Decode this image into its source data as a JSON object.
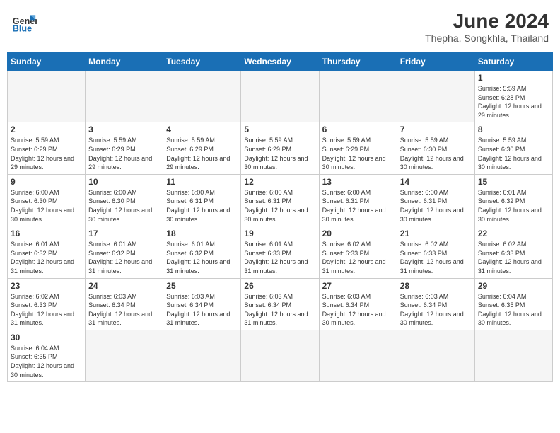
{
  "header": {
    "logo_general": "General",
    "logo_blue": "Blue",
    "month_title": "June 2024",
    "location": "Thepha, Songkhla, Thailand"
  },
  "weekdays": [
    "Sunday",
    "Monday",
    "Tuesday",
    "Wednesday",
    "Thursday",
    "Friday",
    "Saturday"
  ],
  "days": [
    {
      "date": "",
      "empty": true
    },
    {
      "date": "",
      "empty": true
    },
    {
      "date": "",
      "empty": true
    },
    {
      "date": "",
      "empty": true
    },
    {
      "date": "",
      "empty": true
    },
    {
      "date": "",
      "empty": true
    },
    {
      "date": "1",
      "sunrise": "Sunrise: 5:59 AM",
      "sunset": "Sunset: 6:28 PM",
      "daylight": "Daylight: 12 hours and 29 minutes."
    },
    {
      "date": "2",
      "sunrise": "Sunrise: 5:59 AM",
      "sunset": "Sunset: 6:29 PM",
      "daylight": "Daylight: 12 hours and 29 minutes."
    },
    {
      "date": "3",
      "sunrise": "Sunrise: 5:59 AM",
      "sunset": "Sunset: 6:29 PM",
      "daylight": "Daylight: 12 hours and 29 minutes."
    },
    {
      "date": "4",
      "sunrise": "Sunrise: 5:59 AM",
      "sunset": "Sunset: 6:29 PM",
      "daylight": "Daylight: 12 hours and 29 minutes."
    },
    {
      "date": "5",
      "sunrise": "Sunrise: 5:59 AM",
      "sunset": "Sunset: 6:29 PM",
      "daylight": "Daylight: 12 hours and 30 minutes."
    },
    {
      "date": "6",
      "sunrise": "Sunrise: 5:59 AM",
      "sunset": "Sunset: 6:29 PM",
      "daylight": "Daylight: 12 hours and 30 minutes."
    },
    {
      "date": "7",
      "sunrise": "Sunrise: 5:59 AM",
      "sunset": "Sunset: 6:30 PM",
      "daylight": "Daylight: 12 hours and 30 minutes."
    },
    {
      "date": "8",
      "sunrise": "Sunrise: 5:59 AM",
      "sunset": "Sunset: 6:30 PM",
      "daylight": "Daylight: 12 hours and 30 minutes."
    },
    {
      "date": "9",
      "sunrise": "Sunrise: 6:00 AM",
      "sunset": "Sunset: 6:30 PM",
      "daylight": "Daylight: 12 hours and 30 minutes."
    },
    {
      "date": "10",
      "sunrise": "Sunrise: 6:00 AM",
      "sunset": "Sunset: 6:30 PM",
      "daylight": "Daylight: 12 hours and 30 minutes."
    },
    {
      "date": "11",
      "sunrise": "Sunrise: 6:00 AM",
      "sunset": "Sunset: 6:31 PM",
      "daylight": "Daylight: 12 hours and 30 minutes."
    },
    {
      "date": "12",
      "sunrise": "Sunrise: 6:00 AM",
      "sunset": "Sunset: 6:31 PM",
      "daylight": "Daylight: 12 hours and 30 minutes."
    },
    {
      "date": "13",
      "sunrise": "Sunrise: 6:00 AM",
      "sunset": "Sunset: 6:31 PM",
      "daylight": "Daylight: 12 hours and 30 minutes."
    },
    {
      "date": "14",
      "sunrise": "Sunrise: 6:00 AM",
      "sunset": "Sunset: 6:31 PM",
      "daylight": "Daylight: 12 hours and 30 minutes."
    },
    {
      "date": "15",
      "sunrise": "Sunrise: 6:01 AM",
      "sunset": "Sunset: 6:32 PM",
      "daylight": "Daylight: 12 hours and 30 minutes."
    },
    {
      "date": "16",
      "sunrise": "Sunrise: 6:01 AM",
      "sunset": "Sunset: 6:32 PM",
      "daylight": "Daylight: 12 hours and 31 minutes."
    },
    {
      "date": "17",
      "sunrise": "Sunrise: 6:01 AM",
      "sunset": "Sunset: 6:32 PM",
      "daylight": "Daylight: 12 hours and 31 minutes."
    },
    {
      "date": "18",
      "sunrise": "Sunrise: 6:01 AM",
      "sunset": "Sunset: 6:32 PM",
      "daylight": "Daylight: 12 hours and 31 minutes."
    },
    {
      "date": "19",
      "sunrise": "Sunrise: 6:01 AM",
      "sunset": "Sunset: 6:33 PM",
      "daylight": "Daylight: 12 hours and 31 minutes."
    },
    {
      "date": "20",
      "sunrise": "Sunrise: 6:02 AM",
      "sunset": "Sunset: 6:33 PM",
      "daylight": "Daylight: 12 hours and 31 minutes."
    },
    {
      "date": "21",
      "sunrise": "Sunrise: 6:02 AM",
      "sunset": "Sunset: 6:33 PM",
      "daylight": "Daylight: 12 hours and 31 minutes."
    },
    {
      "date": "22",
      "sunrise": "Sunrise: 6:02 AM",
      "sunset": "Sunset: 6:33 PM",
      "daylight": "Daylight: 12 hours and 31 minutes."
    },
    {
      "date": "23",
      "sunrise": "Sunrise: 6:02 AM",
      "sunset": "Sunset: 6:33 PM",
      "daylight": "Daylight: 12 hours and 31 minutes."
    },
    {
      "date": "24",
      "sunrise": "Sunrise: 6:03 AM",
      "sunset": "Sunset: 6:34 PM",
      "daylight": "Daylight: 12 hours and 31 minutes."
    },
    {
      "date": "25",
      "sunrise": "Sunrise: 6:03 AM",
      "sunset": "Sunset: 6:34 PM",
      "daylight": "Daylight: 12 hours and 31 minutes."
    },
    {
      "date": "26",
      "sunrise": "Sunrise: 6:03 AM",
      "sunset": "Sunset: 6:34 PM",
      "daylight": "Daylight: 12 hours and 31 minutes."
    },
    {
      "date": "27",
      "sunrise": "Sunrise: 6:03 AM",
      "sunset": "Sunset: 6:34 PM",
      "daylight": "Daylight: 12 hours and 30 minutes."
    },
    {
      "date": "28",
      "sunrise": "Sunrise: 6:03 AM",
      "sunset": "Sunset: 6:34 PM",
      "daylight": "Daylight: 12 hours and 30 minutes."
    },
    {
      "date": "29",
      "sunrise": "Sunrise: 6:04 AM",
      "sunset": "Sunset: 6:35 PM",
      "daylight": "Daylight: 12 hours and 30 minutes."
    },
    {
      "date": "30",
      "sunrise": "Sunrise: 6:04 AM",
      "sunset": "Sunset: 6:35 PM",
      "daylight": "Daylight: 12 hours and 30 minutes."
    },
    {
      "date": "",
      "empty": true
    },
    {
      "date": "",
      "empty": true
    },
    {
      "date": "",
      "empty": true
    },
    {
      "date": "",
      "empty": true
    },
    {
      "date": "",
      "empty": true
    },
    {
      "date": "",
      "empty": true
    }
  ]
}
